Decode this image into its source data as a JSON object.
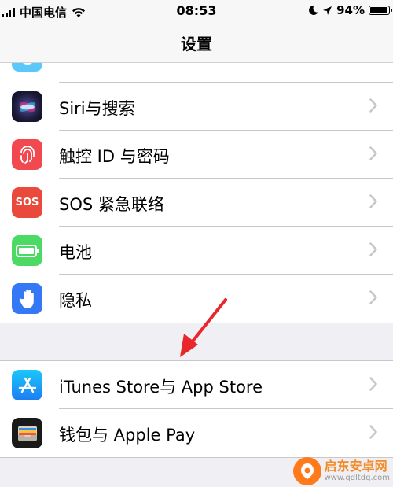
{
  "status_bar": {
    "carrier": "中国电信",
    "time": "08:53",
    "battery_percent": "94%",
    "battery_level": 0.94
  },
  "nav": {
    "title": "设置"
  },
  "top_group": {
    "rows": [
      {
        "label": "",
        "icon": "accessibility-icon",
        "color": "#5ac8fa"
      },
      {
        "label": "Siri与搜索",
        "icon": "siri-icon"
      },
      {
        "label": "触控 ID 与密码",
        "icon": "fingerprint-icon",
        "color": "#f2484f"
      },
      {
        "label": "SOS 紧急联络",
        "icon": "sos-icon",
        "icon_text": "SOS",
        "color": "#ea4a3c"
      },
      {
        "label": "电池",
        "icon": "battery-icon",
        "color": "#4cd964"
      },
      {
        "label": "隐私",
        "icon": "hand-icon",
        "color": "#3478f6"
      }
    ]
  },
  "bottom_group": {
    "rows": [
      {
        "label": "iTunes Store与 App Store",
        "icon": "app-store-icon",
        "color": "#1d7cf2"
      },
      {
        "label": "钱包与 Apple Pay",
        "icon": "wallet-icon",
        "color": "#1a1a1a"
      }
    ]
  },
  "watermark": {
    "title": "启东安卓网",
    "url": "www.qdltdq.com"
  },
  "colors": {
    "background": "#efeff4",
    "annotation_arrow": "#e8262b"
  }
}
